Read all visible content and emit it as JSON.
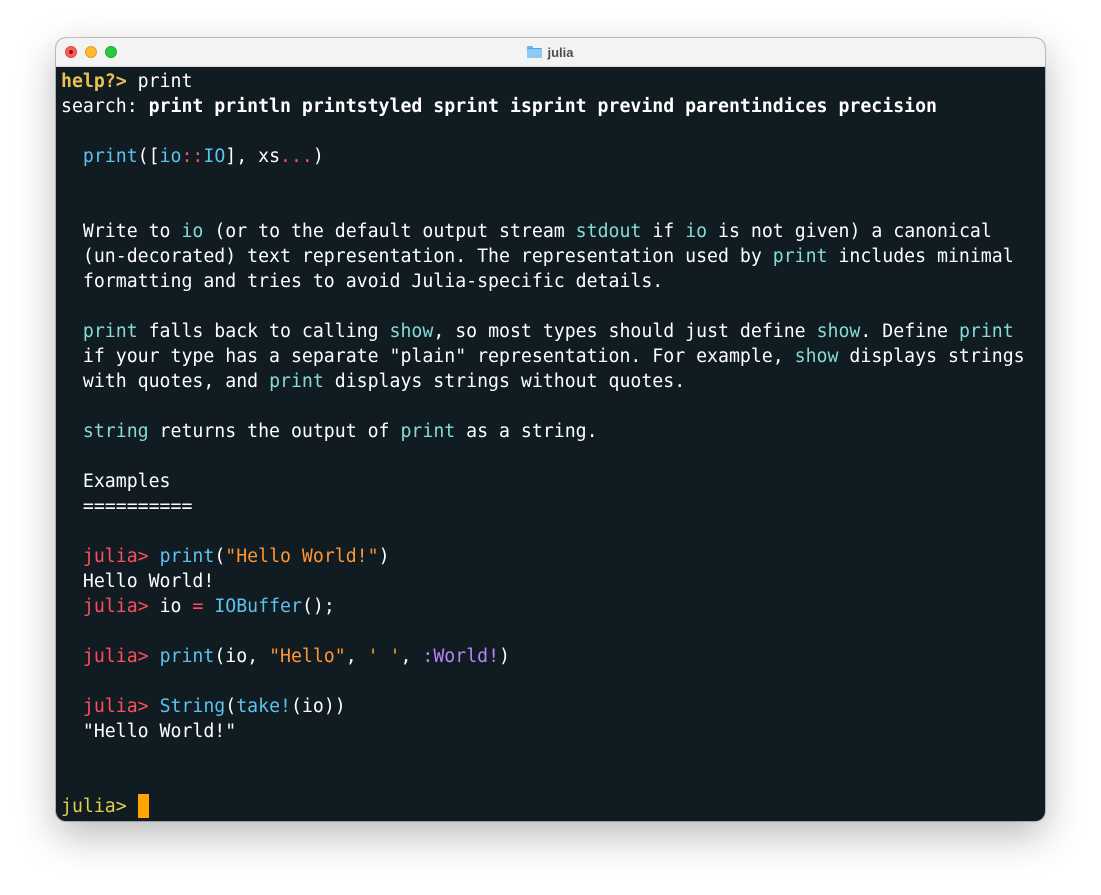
{
  "window": {
    "title": "julia",
    "title_icon": "folder-icon"
  },
  "colors": {
    "background": "#111b22",
    "prompt_help": "#e6c44d",
    "prompt_julia": "#ff4d5f",
    "prompt_repl": "#ddd24a",
    "identifier": "#5cc2ee",
    "code_reference": "#86dbd7",
    "string": "#ff9533",
    "symbol": "#b584f7",
    "cursor": "#ffa400"
  },
  "terminal": {
    "help_prompt": "help?>",
    "help_query": " print",
    "search_label": "search:",
    "search_results": " print println printstyled sprint isprint prevind parentindices precision",
    "sig": {
      "fn": "print",
      "paren_open": "([",
      "io": "io",
      "colons": "::",
      "type": "IO",
      "rest": "], xs",
      "dots": "...",
      "close": ")"
    },
    "p1": {
      "l1a": "Write to ",
      "l1b": "io",
      "l1c": " (or to the default output stream ",
      "l1d": "stdout",
      "l1e": " if ",
      "l1f": "io",
      "l1g": " is not given) a canonical",
      "l2a": "(un-decorated) text representation. The representation used by ",
      "l2b": "print",
      "l2c": " includes minimal",
      "l3": "formatting and tries to avoid Julia-specific details."
    },
    "p2": {
      "l1a": "print",
      "l1b": " falls back to calling ",
      "l1c": "show",
      "l1d": ", so most types should just define ",
      "l1e": "show",
      "l1f": ". Define ",
      "l1g": "print",
      "l2a": "if your type has a separate \"plain\" representation. For example, ",
      "l2b": "show",
      "l2c": " displays strings",
      "l3a": "with quotes, and ",
      "l3b": "print",
      "l3c": " displays strings without quotes."
    },
    "p3": {
      "a": "string",
      "b": " returns the output of ",
      "c": "print",
      "d": " as a string."
    },
    "examples_heading": "Examples",
    "examples_underline": "==========",
    "ex": {
      "prompt": "julia>",
      "e1_fn": "print",
      "e1_open": "(",
      "e1_str": "\"Hello World!\"",
      "e1_close": ")",
      "e1_out": "Hello World!",
      "e2_a": "io ",
      "e2_eq": "=",
      "e2_fn": "IOBuffer",
      "e2_rest": "();",
      "e3_fn": "print",
      "e3_a": "(io, ",
      "e3_str": "\"Hello\"",
      "e3_comma1": ", ",
      "e3_char": "' '",
      "e3_comma2": ", ",
      "e3_sym": ":World!",
      "e3_close": ")",
      "e4_fn1": "String",
      "e4_open": "(",
      "e4_fn2": "take!",
      "e4_rest": "(io))",
      "e4_out": "\"Hello World!\""
    },
    "repl_prompt": "julia>"
  }
}
